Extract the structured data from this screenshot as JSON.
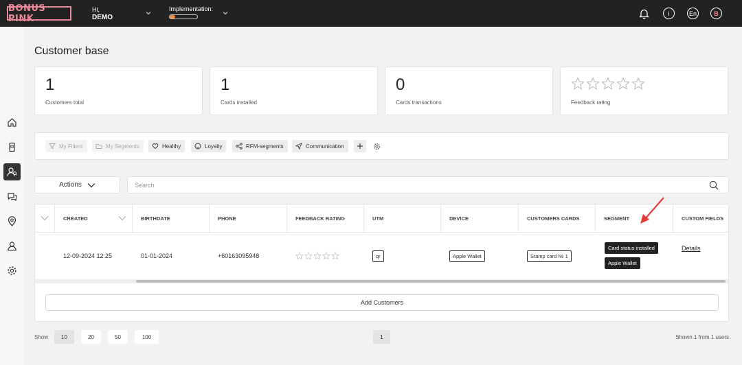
{
  "topbar": {
    "logo": "BONUS PINK",
    "greeting": "Hi,",
    "user": "DEMO",
    "implementation_label": "Implementation:",
    "implementation_progress": 0.2,
    "lang": "En",
    "avatar_letter": "B",
    "info_glyph": "i"
  },
  "page": {
    "title": "Customer base"
  },
  "stats": [
    {
      "value": "1",
      "label": "Customers total"
    },
    {
      "value": "1",
      "label": "Cards installed"
    },
    {
      "value": "0",
      "label": "Cards transactions"
    },
    {
      "label": "Feedback rating",
      "rating": 0,
      "max": 5
    }
  ],
  "filters": [
    {
      "label": "My Filters",
      "icon": "filter-icon",
      "enabled": false
    },
    {
      "label": "My Segments",
      "icon": "folder-icon",
      "enabled": false
    },
    {
      "label": "Healthy",
      "icon": "heart-icon",
      "enabled": true
    },
    {
      "label": "Loyalty",
      "icon": "smile-icon",
      "enabled": true
    },
    {
      "label": "RFM-segments",
      "icon": "nodes-icon",
      "enabled": true
    },
    {
      "label": "Communication",
      "icon": "send-icon",
      "enabled": true
    }
  ],
  "toolbar": {
    "actions_label": "Actions",
    "search_placeholder": "Search"
  },
  "table": {
    "columns": [
      "CREATED",
      "BIRTHDATE",
      "PHONE",
      "FEEDBACK RATING",
      "UTM",
      "DEVICE",
      "CUSTOMERS CARDS",
      "SEGMENT",
      "CUSTOM FIELDS"
    ],
    "row": {
      "created": "12-09-2024 12:25",
      "birthdate": "01-01-2024",
      "phone": "+60163095948",
      "rating": 0,
      "utm": "qr",
      "device": "Apple Wallet",
      "card": "Stamp card № 1",
      "segments": [
        "Card status installed",
        "Apple Wallet"
      ],
      "custom_fields": "Details"
    },
    "add_label": "Add Customers"
  },
  "footer": {
    "show_label": "Show",
    "page_sizes": [
      "10",
      "20",
      "50",
      "100"
    ],
    "active_page_size": "10",
    "current_page": "1",
    "shown_text": "Shown 1 from 1 users"
  },
  "colors": {
    "brand": "#e8889a",
    "topbar": "#222222",
    "progress": "#f08a3c",
    "annotation_arrow": "#e53935"
  }
}
